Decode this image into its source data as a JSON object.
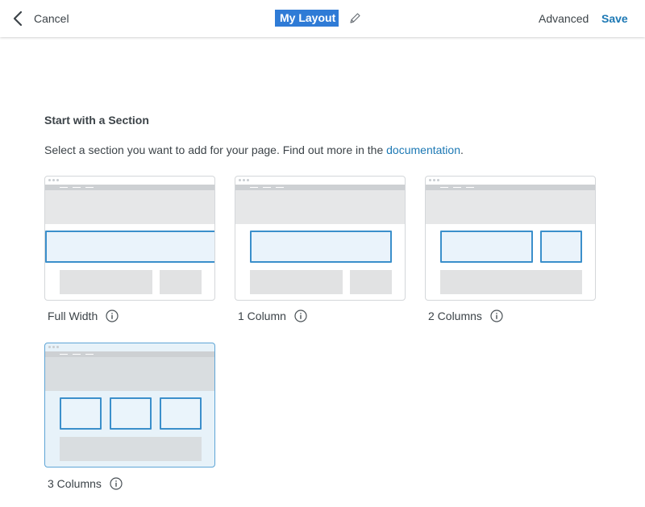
{
  "header": {
    "cancel_label": "Cancel",
    "layout_title": "My Layout",
    "advanced_label": "Advanced",
    "save_label": "Save"
  },
  "section": {
    "heading": "Start with a Section",
    "description_prefix": "Select a section you want to add for your page. Find out more in the ",
    "documentation_link": "documentation",
    "description_suffix": "."
  },
  "options": [
    {
      "label": "Full Width",
      "selected": false
    },
    {
      "label": "1 Column",
      "selected": false
    },
    {
      "label": "2 Columns",
      "selected": false
    },
    {
      "label": "3 Columns",
      "selected": true
    }
  ],
  "colors": {
    "accent": "#1c78b4",
    "selection": "#2f7bd6",
    "section_border": "#3b8fcb"
  }
}
